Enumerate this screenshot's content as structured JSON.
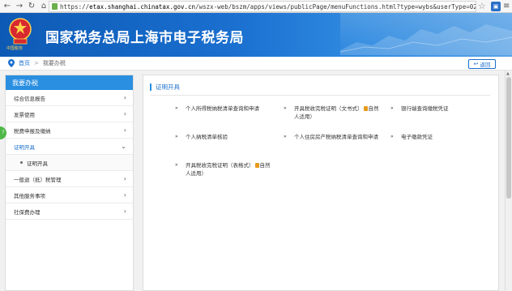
{
  "browser": {
    "url_prefix": "https://",
    "url_host": "etax.shanghai.chinatax.gov.cn",
    "url_path": "/wszx-web/bszm/apps/views/publicPage/menuFunctions.html?type=wybs&userType=02&id=9835&code=zm"
  },
  "header": {
    "title": "国家税务总局上海市电子税务局",
    "emblem_text": "中国税务"
  },
  "breadcrumb": {
    "home": "首页",
    "separator": ">",
    "current": "我要办税",
    "back_label": "返回"
  },
  "sidebar": {
    "heading": "我要办税",
    "items": [
      {
        "label": "综合信息报告",
        "chevron": "›"
      },
      {
        "label": "发票使用",
        "chevron": "›"
      },
      {
        "label": "税费申报及缴纳",
        "chevron": "›"
      },
      {
        "label": "证明开具",
        "chevron": "⌄"
      },
      {
        "label": "一般退（抵）税管理",
        "chevron": "›"
      },
      {
        "label": "其他服务事项",
        "chevron": "›"
      },
      {
        "label": "社保费办理",
        "chevron": "›"
      }
    ],
    "sub_item": "证明开具",
    "float_tab": "?"
  },
  "main": {
    "section_title": "证明开具",
    "links": [
      {
        "text": "个人所得税纳税清单查询和申请"
      },
      {
        "text_a": "开具税收完税证明（文书式）",
        "text_b": "自然人适用）"
      },
      {
        "text": "银行端查询缴税凭证"
      },
      {
        "text": "个人纳税清单核验"
      },
      {
        "text_a": "个人住房房产税纳税清单查询和申",
        "text_b": "请"
      },
      {
        "text": "电子缴款凭证"
      },
      {
        "text_a": "开具税收完税证明（表格式）",
        "text_b": "自然人适用）"
      }
    ],
    "arrow_glyph": "»"
  },
  "colors": {
    "brand_blue": "#1a6fcf",
    "sidebar_head": "#2a8fe0"
  }
}
